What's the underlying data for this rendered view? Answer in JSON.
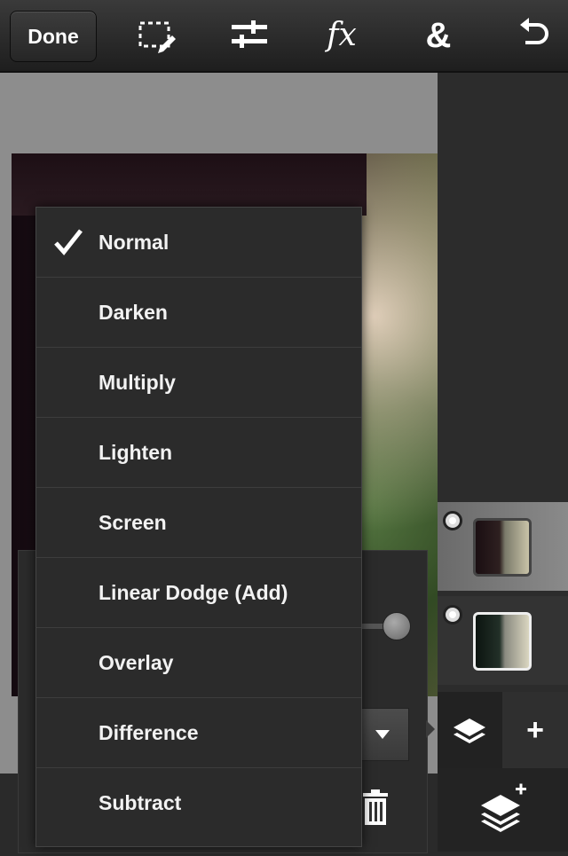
{
  "toolbar": {
    "done_label": "Done",
    "tools": [
      {
        "icon": "selection-edit-icon"
      },
      {
        "icon": "adjustments-icon"
      },
      {
        "icon": "fx-icon",
        "label": "fx"
      },
      {
        "icon": "ampersand-icon",
        "label": "&"
      },
      {
        "icon": "undo-icon"
      }
    ]
  },
  "blend_menu": {
    "selected": "Normal",
    "items": [
      "Normal",
      "Darken",
      "Multiply",
      "Lighten",
      "Screen",
      "Linear Dodge (Add)",
      "Overlay",
      "Difference",
      "Subtract"
    ]
  },
  "layers": {
    "items": [
      {
        "state": "active",
        "visible": true
      },
      {
        "state": "inactive",
        "visible": true
      }
    ],
    "add_label": "+"
  }
}
